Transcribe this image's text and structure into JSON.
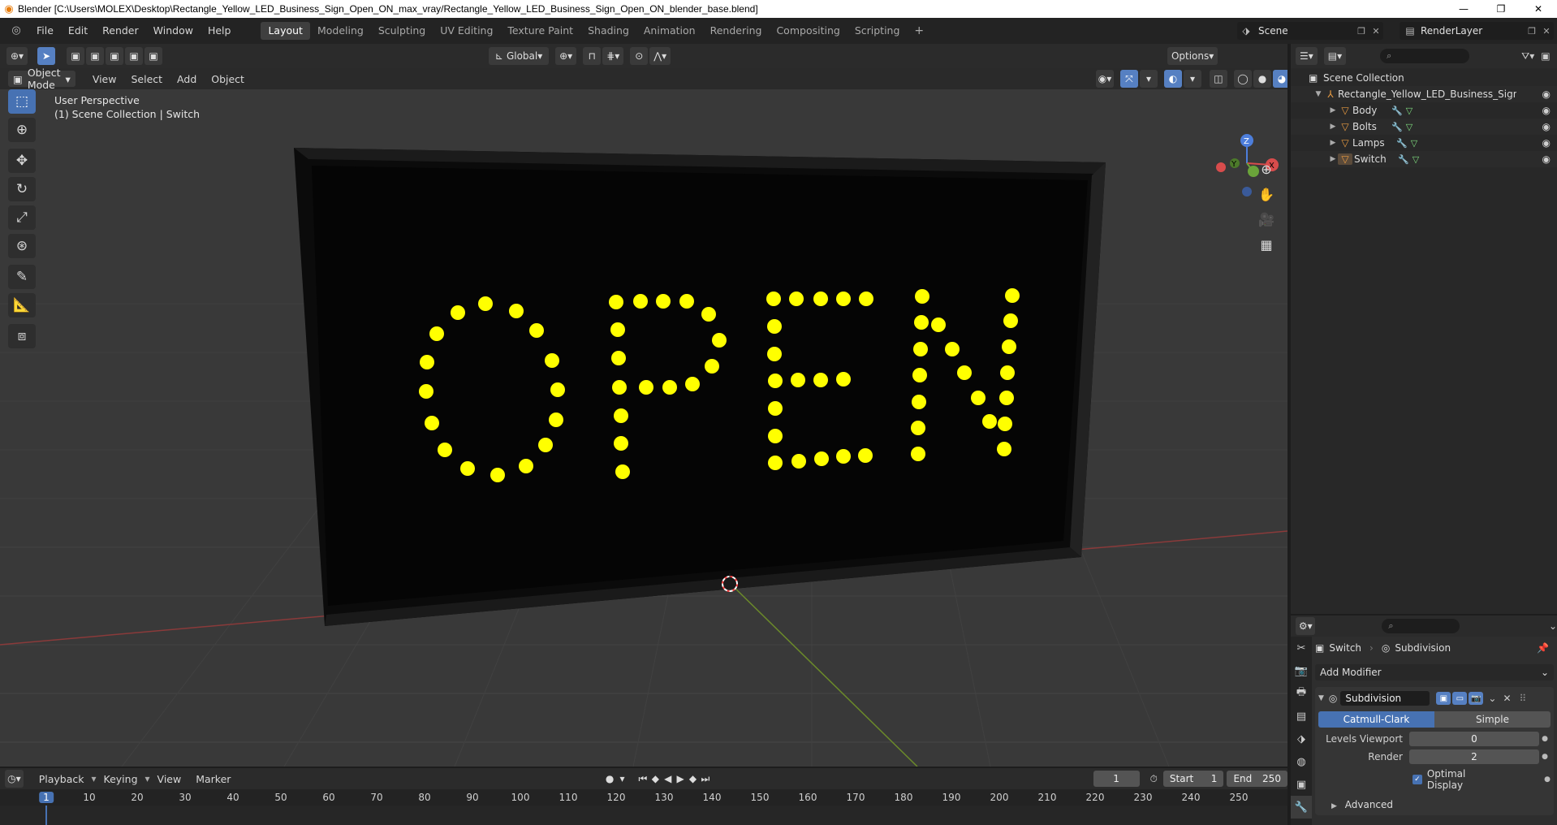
{
  "window": {
    "title": "Blender [C:\\Users\\MOLEX\\Desktop\\Rectangle_Yellow_LED_Business_Sign_Open_ON_max_vray/Rectangle_Yellow_LED_Business_Sign_Open_ON_blender_base.blend]",
    "minimize": "—",
    "maximize": "❐",
    "close": "✕"
  },
  "menu": {
    "items": [
      "File",
      "Edit",
      "Render",
      "Window",
      "Help"
    ]
  },
  "workspaces": {
    "tabs": [
      "Layout",
      "Modeling",
      "Sculpting",
      "UV Editing",
      "Texture Paint",
      "Shading",
      "Animation",
      "Rendering",
      "Compositing",
      "Scripting"
    ],
    "active": "Layout"
  },
  "scene": {
    "name": "Scene"
  },
  "renderlayer": {
    "name": "RenderLayer"
  },
  "viewport": {
    "transform_orientation": "Global",
    "options_label": "Options",
    "mode": "Object Mode",
    "header_menus": [
      "View",
      "Select",
      "Add",
      "Object"
    ],
    "perspective_label": "User Perspective",
    "collection_label": "(1) Scene Collection | Switch",
    "sign_text": "OPEN",
    "axes": {
      "x": "X",
      "y": "Y",
      "z": "Z"
    }
  },
  "outliner": {
    "root": "Scene Collection",
    "collection": "Rectangle_Yellow_LED_Business_Sign_Open",
    "objects": [
      "Body",
      "Bolts",
      "Lamps",
      "Switch"
    ]
  },
  "properties": {
    "object_name": "Switch",
    "modifier_crumb": "Subdivision",
    "add_modifier": "Add Modifier",
    "modifier": {
      "name": "Subdivision",
      "methods": [
        "Catmull-Clark",
        "Simple"
      ],
      "active_method": "Catmull-Clark",
      "levels_viewport_label": "Levels Viewport",
      "levels_viewport": "0",
      "render_label": "Render",
      "render": "2",
      "optimal_display_label": "Optimal Display",
      "optimal_display": true,
      "advanced_label": "Advanced"
    }
  },
  "timeline": {
    "menus": [
      "Playback",
      "Keying",
      "View",
      "Marker"
    ],
    "current_frame": "1",
    "start_label": "Start",
    "start": "1",
    "end_label": "End",
    "end": "250",
    "ruler": [
      "1",
      "10",
      "20",
      "30",
      "40",
      "50",
      "60",
      "70",
      "80",
      "90",
      "100",
      "110",
      "120",
      "130",
      "140",
      "150",
      "160",
      "170",
      "180",
      "190",
      "200",
      "210",
      "220",
      "230",
      "240",
      "250"
    ]
  },
  "colors": {
    "accent": "#4772b3",
    "led": "#ffff00",
    "viewport_bg": "#393939"
  }
}
